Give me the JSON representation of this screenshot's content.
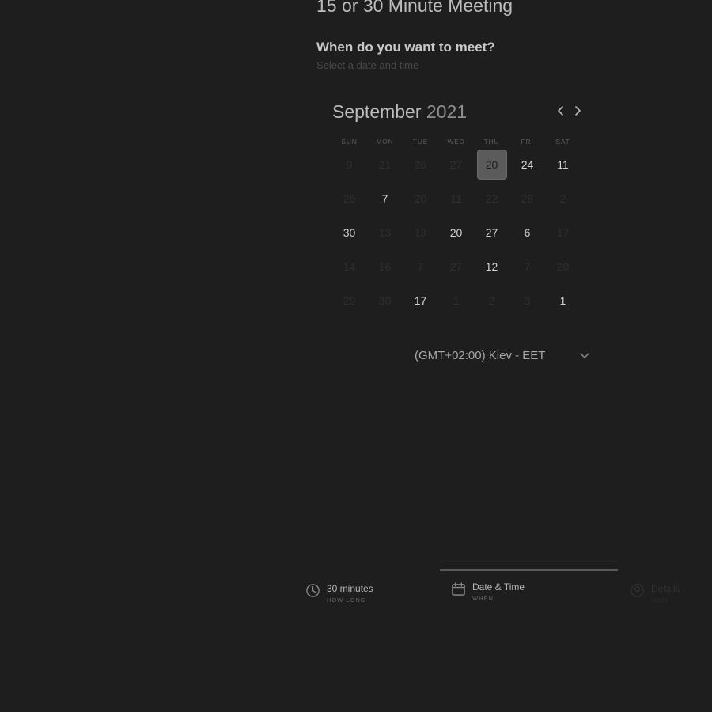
{
  "header": {
    "title": "15 or 30 Minute Meeting",
    "question": "When do you want to meet?",
    "subtitle": "Select a date and time"
  },
  "calendar": {
    "month": "September",
    "year": "2021",
    "weekdays": [
      "SUN",
      "MON",
      "TUE",
      "WED",
      "THU",
      "FRI",
      "SAT"
    ],
    "days": [
      {
        "label": "9",
        "state": "faded"
      },
      {
        "label": "21",
        "state": "faded"
      },
      {
        "label": "26",
        "state": "faded"
      },
      {
        "label": "27",
        "state": "faded"
      },
      {
        "label": "20",
        "state": "selected"
      },
      {
        "label": "24",
        "state": "available"
      },
      {
        "label": "11",
        "state": "available"
      },
      {
        "label": "26",
        "state": "faded"
      },
      {
        "label": "7",
        "state": "available"
      },
      {
        "label": "20",
        "state": "faded"
      },
      {
        "label": "11",
        "state": "faded"
      },
      {
        "label": "22",
        "state": "faded"
      },
      {
        "label": "28",
        "state": "faded"
      },
      {
        "label": "2",
        "state": "faded"
      },
      {
        "label": "30",
        "state": "available"
      },
      {
        "label": "13",
        "state": "faded"
      },
      {
        "label": "13",
        "state": "faded"
      },
      {
        "label": "20",
        "state": "available"
      },
      {
        "label": "27",
        "state": "available"
      },
      {
        "label": "6",
        "state": "available"
      },
      {
        "label": "17",
        "state": "faded"
      },
      {
        "label": "14",
        "state": "faded"
      },
      {
        "label": "16",
        "state": "faded"
      },
      {
        "label": "7",
        "state": "faded"
      },
      {
        "label": "27",
        "state": "faded"
      },
      {
        "label": "12",
        "state": "available"
      },
      {
        "label": "7",
        "state": "faded"
      },
      {
        "label": "20",
        "state": "faded"
      },
      {
        "label": "29",
        "state": "faded"
      },
      {
        "label": "30",
        "state": "faded"
      },
      {
        "label": "17",
        "state": "available"
      },
      {
        "label": "1",
        "state": "faded"
      },
      {
        "label": "2",
        "state": "faded"
      },
      {
        "label": "3",
        "state": "faded"
      },
      {
        "label": "1",
        "state": "available"
      }
    ]
  },
  "timezone": {
    "value": "(GMT+02:00) Kiev - EET"
  },
  "steps": [
    {
      "label": "30 minutes",
      "caption": "HOW LONG",
      "icon": "clock-icon"
    },
    {
      "label": "Date & Time",
      "caption": "WHEN",
      "icon": "calendar-icon"
    },
    {
      "label": "Details",
      "caption": "WHO",
      "icon": "user-icon"
    }
  ],
  "colors": {
    "background": "#1e1e1e",
    "selected_day": "#5b5b5b",
    "active_step_bar": "#5a5a5a"
  }
}
